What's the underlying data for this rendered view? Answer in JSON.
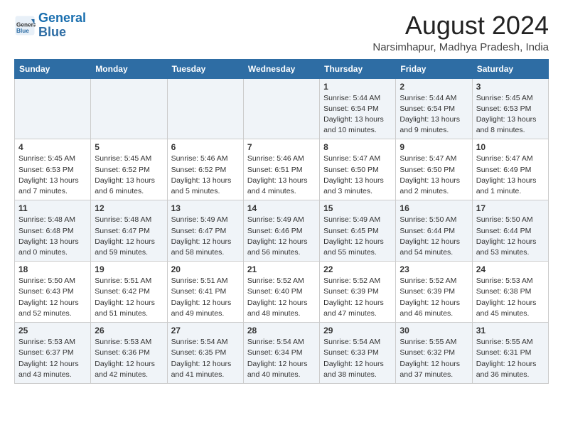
{
  "logo": {
    "text_general": "General",
    "text_blue": "Blue"
  },
  "title": "August 2024",
  "subtitle": "Narsimhapur, Madhya Pradesh, India",
  "days_of_week": [
    "Sunday",
    "Monday",
    "Tuesday",
    "Wednesday",
    "Thursday",
    "Friday",
    "Saturday"
  ],
  "weeks": [
    [
      {
        "day": "",
        "info": ""
      },
      {
        "day": "",
        "info": ""
      },
      {
        "day": "",
        "info": ""
      },
      {
        "day": "",
        "info": ""
      },
      {
        "day": "1",
        "info": "Sunrise: 5:44 AM\nSunset: 6:54 PM\nDaylight: 13 hours and 10 minutes."
      },
      {
        "day": "2",
        "info": "Sunrise: 5:44 AM\nSunset: 6:54 PM\nDaylight: 13 hours and 9 minutes."
      },
      {
        "day": "3",
        "info": "Sunrise: 5:45 AM\nSunset: 6:53 PM\nDaylight: 13 hours and 8 minutes."
      }
    ],
    [
      {
        "day": "4",
        "info": "Sunrise: 5:45 AM\nSunset: 6:53 PM\nDaylight: 13 hours and 7 minutes."
      },
      {
        "day": "5",
        "info": "Sunrise: 5:45 AM\nSunset: 6:52 PM\nDaylight: 13 hours and 6 minutes."
      },
      {
        "day": "6",
        "info": "Sunrise: 5:46 AM\nSunset: 6:52 PM\nDaylight: 13 hours and 5 minutes."
      },
      {
        "day": "7",
        "info": "Sunrise: 5:46 AM\nSunset: 6:51 PM\nDaylight: 13 hours and 4 minutes."
      },
      {
        "day": "8",
        "info": "Sunrise: 5:47 AM\nSunset: 6:50 PM\nDaylight: 13 hours and 3 minutes."
      },
      {
        "day": "9",
        "info": "Sunrise: 5:47 AM\nSunset: 6:50 PM\nDaylight: 13 hours and 2 minutes."
      },
      {
        "day": "10",
        "info": "Sunrise: 5:47 AM\nSunset: 6:49 PM\nDaylight: 13 hours and 1 minute."
      }
    ],
    [
      {
        "day": "11",
        "info": "Sunrise: 5:48 AM\nSunset: 6:48 PM\nDaylight: 13 hours and 0 minutes."
      },
      {
        "day": "12",
        "info": "Sunrise: 5:48 AM\nSunset: 6:47 PM\nDaylight: 12 hours and 59 minutes."
      },
      {
        "day": "13",
        "info": "Sunrise: 5:49 AM\nSunset: 6:47 PM\nDaylight: 12 hours and 58 minutes."
      },
      {
        "day": "14",
        "info": "Sunrise: 5:49 AM\nSunset: 6:46 PM\nDaylight: 12 hours and 56 minutes."
      },
      {
        "day": "15",
        "info": "Sunrise: 5:49 AM\nSunset: 6:45 PM\nDaylight: 12 hours and 55 minutes."
      },
      {
        "day": "16",
        "info": "Sunrise: 5:50 AM\nSunset: 6:44 PM\nDaylight: 12 hours and 54 minutes."
      },
      {
        "day": "17",
        "info": "Sunrise: 5:50 AM\nSunset: 6:44 PM\nDaylight: 12 hours and 53 minutes."
      }
    ],
    [
      {
        "day": "18",
        "info": "Sunrise: 5:50 AM\nSunset: 6:43 PM\nDaylight: 12 hours and 52 minutes."
      },
      {
        "day": "19",
        "info": "Sunrise: 5:51 AM\nSunset: 6:42 PM\nDaylight: 12 hours and 51 minutes."
      },
      {
        "day": "20",
        "info": "Sunrise: 5:51 AM\nSunset: 6:41 PM\nDaylight: 12 hours and 49 minutes."
      },
      {
        "day": "21",
        "info": "Sunrise: 5:52 AM\nSunset: 6:40 PM\nDaylight: 12 hours and 48 minutes."
      },
      {
        "day": "22",
        "info": "Sunrise: 5:52 AM\nSunset: 6:39 PM\nDaylight: 12 hours and 47 minutes."
      },
      {
        "day": "23",
        "info": "Sunrise: 5:52 AM\nSunset: 6:39 PM\nDaylight: 12 hours and 46 minutes."
      },
      {
        "day": "24",
        "info": "Sunrise: 5:53 AM\nSunset: 6:38 PM\nDaylight: 12 hours and 45 minutes."
      }
    ],
    [
      {
        "day": "25",
        "info": "Sunrise: 5:53 AM\nSunset: 6:37 PM\nDaylight: 12 hours and 43 minutes."
      },
      {
        "day": "26",
        "info": "Sunrise: 5:53 AM\nSunset: 6:36 PM\nDaylight: 12 hours and 42 minutes."
      },
      {
        "day": "27",
        "info": "Sunrise: 5:54 AM\nSunset: 6:35 PM\nDaylight: 12 hours and 41 minutes."
      },
      {
        "day": "28",
        "info": "Sunrise: 5:54 AM\nSunset: 6:34 PM\nDaylight: 12 hours and 40 minutes."
      },
      {
        "day": "29",
        "info": "Sunrise: 5:54 AM\nSunset: 6:33 PM\nDaylight: 12 hours and 38 minutes."
      },
      {
        "day": "30",
        "info": "Sunrise: 5:55 AM\nSunset: 6:32 PM\nDaylight: 12 hours and 37 minutes."
      },
      {
        "day": "31",
        "info": "Sunrise: 5:55 AM\nSunset: 6:31 PM\nDaylight: 12 hours and 36 minutes."
      }
    ]
  ]
}
